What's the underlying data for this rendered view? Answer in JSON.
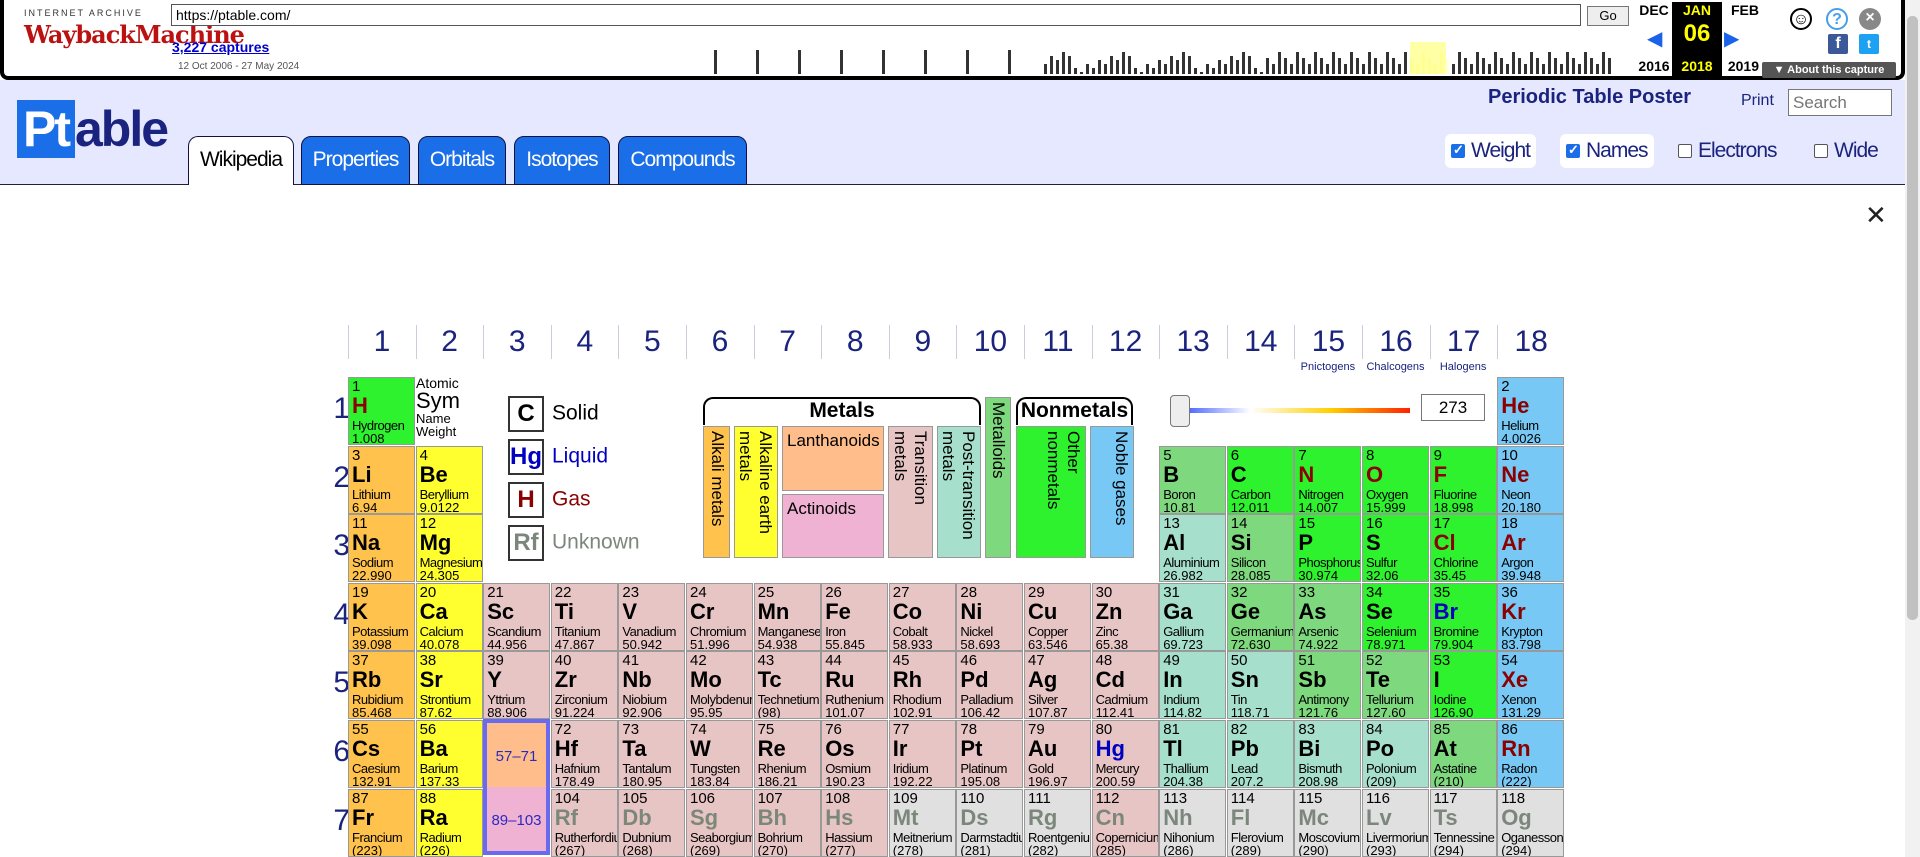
{
  "wayback": {
    "ia": "INTERNET ARCHIVE",
    "wm": "WaybackMachine",
    "url": "https://ptable.com/",
    "go": "Go",
    "captures": "3,227 captures",
    "range": "12 Oct 2006 - 27 May 2024",
    "prev_month": "DEC",
    "cur_month": "JAN",
    "next_month": "FEB",
    "cur_day": "06",
    "prev_year": "2016",
    "cur_year": "2018",
    "next_year": "2019",
    "about": "▼ About this capture"
  },
  "site": {
    "logo_pt": "Pt",
    "logo_rest": "able",
    "title": "Periodic Table Poster",
    "print": "Print",
    "search_placeholder": "Search"
  },
  "tabs": [
    "Wikipedia",
    "Properties",
    "Orbitals",
    "Isotopes",
    "Compounds"
  ],
  "options": [
    {
      "label": "Weight",
      "checked": true
    },
    {
      "label": "Names",
      "checked": true
    },
    {
      "label": "Electrons",
      "checked": false
    },
    {
      "label": "Wide",
      "checked": false
    }
  ],
  "groups": [
    "1",
    "2",
    "3",
    "4",
    "5",
    "6",
    "7",
    "8",
    "9",
    "10",
    "11",
    "12",
    "13",
    "14",
    "15",
    "16",
    "17",
    "18"
  ],
  "group_subs": {
    "15": "Pnictogens",
    "16": "Chalcogens",
    "17": "Halogens"
  },
  "periods": [
    "1",
    "2",
    "3",
    "4",
    "5",
    "6",
    "7"
  ],
  "key": {
    "atomic": "Atomic",
    "sym": "Sym",
    "name": "Name",
    "weight": "Weight"
  },
  "legend": [
    {
      "sym": "C",
      "label": "Solid"
    },
    {
      "sym": "Hg",
      "label": "Liquid"
    },
    {
      "sym": "H",
      "label": "Gas"
    },
    {
      "sym": "Rf",
      "label": "Unknown"
    }
  ],
  "categories": {
    "metals": "Metals",
    "nonmetals": "Nonmetals",
    "alkali": "Alkali metals",
    "alkaline": "Alkaline earth metals",
    "lanthanoids": "Lanthanoids",
    "actinoids": "Actinoids",
    "transition": "Transition metals",
    "post": "Post-transition metals",
    "metalloids": "Metalloids",
    "other": "Other nonmetals",
    "noble": "Noble gases"
  },
  "temperature": "273",
  "ranges": {
    "lan": "57–71",
    "act": "89–103"
  },
  "elements": [
    [
      "1",
      "H",
      "Hydrogen",
      "1.008",
      "non",
      "g",
      1,
      1
    ],
    [
      "2",
      "He",
      "Helium",
      "4.0026",
      "nob",
      "g",
      18,
      1
    ],
    [
      "3",
      "Li",
      "Lithium",
      "6.94",
      "alk",
      "",
      1,
      2
    ],
    [
      "4",
      "Be",
      "Beryllium",
      "9.0122",
      "ale",
      "",
      2,
      2
    ],
    [
      "5",
      "B",
      "Boron",
      "10.81",
      "met",
      "",
      13,
      2
    ],
    [
      "6",
      "C",
      "Carbon",
      "12.011",
      "non",
      "",
      14,
      2
    ],
    [
      "7",
      "N",
      "Nitrogen",
      "14.007",
      "non",
      "g",
      15,
      2
    ],
    [
      "8",
      "O",
      "Oxygen",
      "15.999",
      "non",
      "g",
      16,
      2
    ],
    [
      "9",
      "F",
      "Fluorine",
      "18.998",
      "non",
      "g",
      17,
      2
    ],
    [
      "10",
      "Ne",
      "Neon",
      "20.180",
      "nob",
      "g",
      18,
      2
    ],
    [
      "11",
      "Na",
      "Sodium",
      "22.990",
      "alk",
      "",
      1,
      3
    ],
    [
      "12",
      "Mg",
      "Magnesium",
      "24.305",
      "ale",
      "",
      2,
      3
    ],
    [
      "13",
      "Al",
      "Aluminium",
      "26.982",
      "pst",
      "",
      13,
      3
    ],
    [
      "14",
      "Si",
      "Silicon",
      "28.085",
      "met",
      "",
      14,
      3
    ],
    [
      "15",
      "P",
      "Phosphorus",
      "30.974",
      "non",
      "",
      15,
      3
    ],
    [
      "16",
      "S",
      "Sulfur",
      "32.06",
      "non",
      "",
      16,
      3
    ],
    [
      "17",
      "Cl",
      "Chlorine",
      "35.45",
      "non",
      "g",
      17,
      3
    ],
    [
      "18",
      "Ar",
      "Argon",
      "39.948",
      "nob",
      "g",
      18,
      3
    ],
    [
      "19",
      "K",
      "Potassium",
      "39.098",
      "alk",
      "",
      1,
      4
    ],
    [
      "20",
      "Ca",
      "Calcium",
      "40.078",
      "ale",
      "",
      2,
      4
    ],
    [
      "21",
      "Sc",
      "Scandium",
      "44.956",
      "trn",
      "",
      3,
      4
    ],
    [
      "22",
      "Ti",
      "Titanium",
      "47.867",
      "trn",
      "",
      4,
      4
    ],
    [
      "23",
      "V",
      "Vanadium",
      "50.942",
      "trn",
      "",
      5,
      4
    ],
    [
      "24",
      "Cr",
      "Chromium",
      "51.996",
      "trn",
      "",
      6,
      4
    ],
    [
      "25",
      "Mn",
      "Manganese",
      "54.938",
      "trn",
      "",
      7,
      4
    ],
    [
      "26",
      "Fe",
      "Iron",
      "55.845",
      "trn",
      "",
      8,
      4
    ],
    [
      "27",
      "Co",
      "Cobalt",
      "58.933",
      "trn",
      "",
      9,
      4
    ],
    [
      "28",
      "Ni",
      "Nickel",
      "58.693",
      "trn",
      "",
      10,
      4
    ],
    [
      "29",
      "Cu",
      "Copper",
      "63.546",
      "trn",
      "",
      11,
      4
    ],
    [
      "30",
      "Zn",
      "Zinc",
      "65.38",
      "trn",
      "",
      12,
      4
    ],
    [
      "31",
      "Ga",
      "Gallium",
      "69.723",
      "pst",
      "",
      13,
      4
    ],
    [
      "32",
      "Ge",
      "Germanium",
      "72.630",
      "met",
      "",
      14,
      4
    ],
    [
      "33",
      "As",
      "Arsenic",
      "74.922",
      "met",
      "",
      15,
      4
    ],
    [
      "34",
      "Se",
      "Selenium",
      "78.971",
      "non",
      "",
      16,
      4
    ],
    [
      "35",
      "Br",
      "Bromine",
      "79.904",
      "non",
      "l",
      17,
      4
    ],
    [
      "36",
      "Kr",
      "Krypton",
      "83.798",
      "nob",
      "g",
      18,
      4
    ],
    [
      "37",
      "Rb",
      "Rubidium",
      "85.468",
      "alk",
      "",
      1,
      5
    ],
    [
      "38",
      "Sr",
      "Strontium",
      "87.62",
      "ale",
      "",
      2,
      5
    ],
    [
      "39",
      "Y",
      "Yttrium",
      "88.906",
      "trn",
      "",
      3,
      5
    ],
    [
      "40",
      "Zr",
      "Zirconium",
      "91.224",
      "trn",
      "",
      4,
      5
    ],
    [
      "41",
      "Nb",
      "Niobium",
      "92.906",
      "trn",
      "",
      5,
      5
    ],
    [
      "42",
      "Mo",
      "Molybdenum",
      "95.95",
      "trn",
      "",
      6,
      5
    ],
    [
      "43",
      "Tc",
      "Technetium",
      "(98)",
      "trn",
      "",
      7,
      5
    ],
    [
      "44",
      "Ru",
      "Ruthenium",
      "101.07",
      "trn",
      "",
      8,
      5
    ],
    [
      "45",
      "Rh",
      "Rhodium",
      "102.91",
      "trn",
      "",
      9,
      5
    ],
    [
      "46",
      "Pd",
      "Palladium",
      "106.42",
      "trn",
      "",
      10,
      5
    ],
    [
      "47",
      "Ag",
      "Silver",
      "107.87",
      "trn",
      "",
      11,
      5
    ],
    [
      "48",
      "Cd",
      "Cadmium",
      "112.41",
      "trn",
      "",
      12,
      5
    ],
    [
      "49",
      "In",
      "Indium",
      "114.82",
      "pst",
      "",
      13,
      5
    ],
    [
      "50",
      "Sn",
      "Tin",
      "118.71",
      "pst",
      "",
      14,
      5
    ],
    [
      "51",
      "Sb",
      "Antimony",
      "121.76",
      "met",
      "",
      15,
      5
    ],
    [
      "52",
      "Te",
      "Tellurium",
      "127.60",
      "met",
      "",
      16,
      5
    ],
    [
      "53",
      "I",
      "Iodine",
      "126.90",
      "non",
      "",
      17,
      5
    ],
    [
      "54",
      "Xe",
      "Xenon",
      "131.29",
      "nob",
      "g",
      18,
      5
    ],
    [
      "55",
      "Cs",
      "Caesium",
      "132.91",
      "alk",
      "",
      1,
      6
    ],
    [
      "56",
      "Ba",
      "Barium",
      "137.33",
      "ale",
      "",
      2,
      6
    ],
    [
      "72",
      "Hf",
      "Hafnium",
      "178.49",
      "trn",
      "",
      4,
      6
    ],
    [
      "73",
      "Ta",
      "Tantalum",
      "180.95",
      "trn",
      "",
      5,
      6
    ],
    [
      "74",
      "W",
      "Tungsten",
      "183.84",
      "trn",
      "",
      6,
      6
    ],
    [
      "75",
      "Re",
      "Rhenium",
      "186.21",
      "trn",
      "",
      7,
      6
    ],
    [
      "76",
      "Os",
      "Osmium",
      "190.23",
      "trn",
      "",
      8,
      6
    ],
    [
      "77",
      "Ir",
      "Iridium",
      "192.22",
      "trn",
      "",
      9,
      6
    ],
    [
      "78",
      "Pt",
      "Platinum",
      "195.08",
      "trn",
      "",
      10,
      6
    ],
    [
      "79",
      "Au",
      "Gold",
      "196.97",
      "trn",
      "",
      11,
      6
    ],
    [
      "80",
      "Hg",
      "Mercury",
      "200.59",
      "trn",
      "l",
      12,
      6
    ],
    [
      "81",
      "Tl",
      "Thallium",
      "204.38",
      "pst",
      "",
      13,
      6
    ],
    [
      "82",
      "Pb",
      "Lead",
      "207.2",
      "pst",
      "",
      14,
      6
    ],
    [
      "83",
      "Bi",
      "Bismuth",
      "208.98",
      "pst",
      "",
      15,
      6
    ],
    [
      "84",
      "Po",
      "Polonium",
      "(209)",
      "pst",
      "",
      16,
      6
    ],
    [
      "85",
      "At",
      "Astatine",
      "(210)",
      "met",
      "",
      17,
      6
    ],
    [
      "86",
      "Rn",
      "Radon",
      "(222)",
      "nob",
      "g",
      18,
      6
    ],
    [
      "87",
      "Fr",
      "Francium",
      "(223)",
      "alk",
      "",
      1,
      7
    ],
    [
      "88",
      "Ra",
      "Radium",
      "(226)",
      "ale",
      "",
      2,
      7
    ],
    [
      "104",
      "Rf",
      "Rutherfordium",
      "(267)",
      "trn",
      "u",
      4,
      7
    ],
    [
      "105",
      "Db",
      "Dubnium",
      "(268)",
      "trn",
      "u",
      5,
      7
    ],
    [
      "106",
      "Sg",
      "Seaborgium",
      "(269)",
      "trn",
      "u",
      6,
      7
    ],
    [
      "107",
      "Bh",
      "Bohrium",
      "(270)",
      "trn",
      "u",
      7,
      7
    ],
    [
      "108",
      "Hs",
      "Hassium",
      "(277)",
      "trn",
      "u",
      8,
      7
    ],
    [
      "109",
      "Mt",
      "Meitnerium",
      "(278)",
      "unk",
      "u",
      9,
      7
    ],
    [
      "110",
      "Ds",
      "Darmstadtium",
      "(281)",
      "unk",
      "u",
      10,
      7
    ],
    [
      "111",
      "Rg",
      "Roentgenium",
      "(282)",
      "unk",
      "u",
      11,
      7
    ],
    [
      "112",
      "Cn",
      "Copernicium",
      "(285)",
      "trn",
      "u",
      12,
      7
    ],
    [
      "113",
      "Nh",
      "Nihonium",
      "(286)",
      "unk",
      "u",
      13,
      7
    ],
    [
      "114",
      "Fl",
      "Flerovium",
      "(289)",
      "unk",
      "u",
      14,
      7
    ],
    [
      "115",
      "Mc",
      "Moscovium",
      "(290)",
      "unk",
      "u",
      15,
      7
    ],
    [
      "116",
      "Lv",
      "Livermorium",
      "(293)",
      "unk",
      "u",
      16,
      7
    ],
    [
      "117",
      "Ts",
      "Tennessine",
      "(294)",
      "unk",
      "u",
      17,
      7
    ],
    [
      "118",
      "Og",
      "Oganesson",
      "(294)",
      "unk",
      "u",
      18,
      7
    ]
  ]
}
